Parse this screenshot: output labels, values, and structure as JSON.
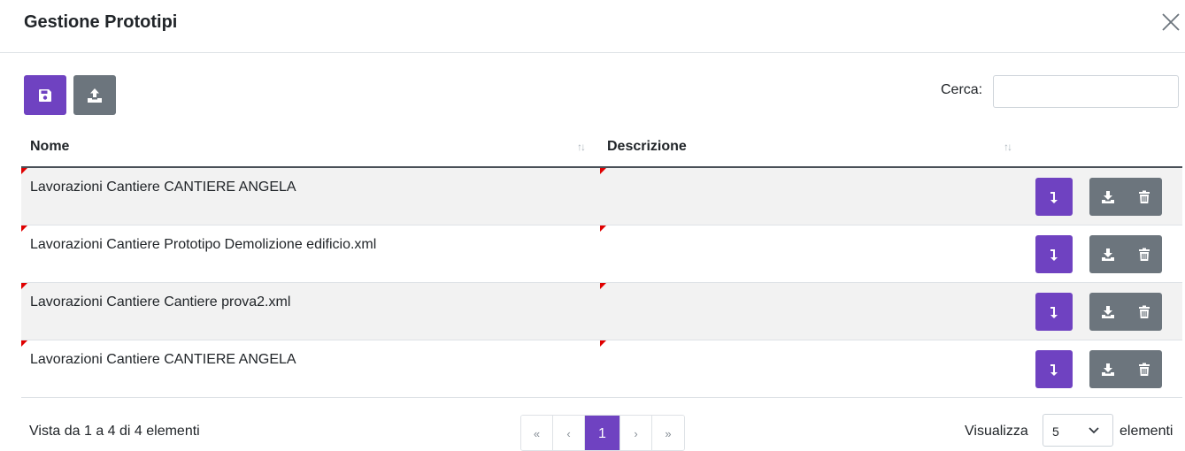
{
  "modal": {
    "title": "Gestione Prototipi"
  },
  "toolbar": {
    "save_icon": "floppy-disk-icon",
    "upload_icon": "upload-icon"
  },
  "search": {
    "label": "Cerca:",
    "value": "",
    "placeholder": ""
  },
  "table": {
    "columns": [
      "Nome",
      "Descrizione"
    ],
    "rows": [
      {
        "nome": "Lavorazioni Cantiere CANTIERE ANGELA",
        "descrizione": ""
      },
      {
        "nome": "Lavorazioni Cantiere Prototipo Demolizione edificio.xml",
        "descrizione": ""
      },
      {
        "nome": "Lavorazioni Cantiere Cantiere prova2.xml",
        "descrizione": ""
      },
      {
        "nome": "Lavorazioni Cantiere CANTIERE ANGELA",
        "descrizione": ""
      }
    ],
    "row_actions": [
      "import-arrow-icon",
      "download-icon",
      "trash-icon"
    ]
  },
  "footer": {
    "info": "Vista da 1 a 4 di 4 elementi",
    "pagination": {
      "first": "«",
      "prev": "‹",
      "current": "1",
      "next": "›",
      "last": "»"
    },
    "length_label": "Visualizza",
    "length_value": "5",
    "length_suffix": "elementi"
  },
  "colors": {
    "primary": "#6f42c1",
    "secondary": "#6c757d",
    "marker": "#e00000"
  }
}
